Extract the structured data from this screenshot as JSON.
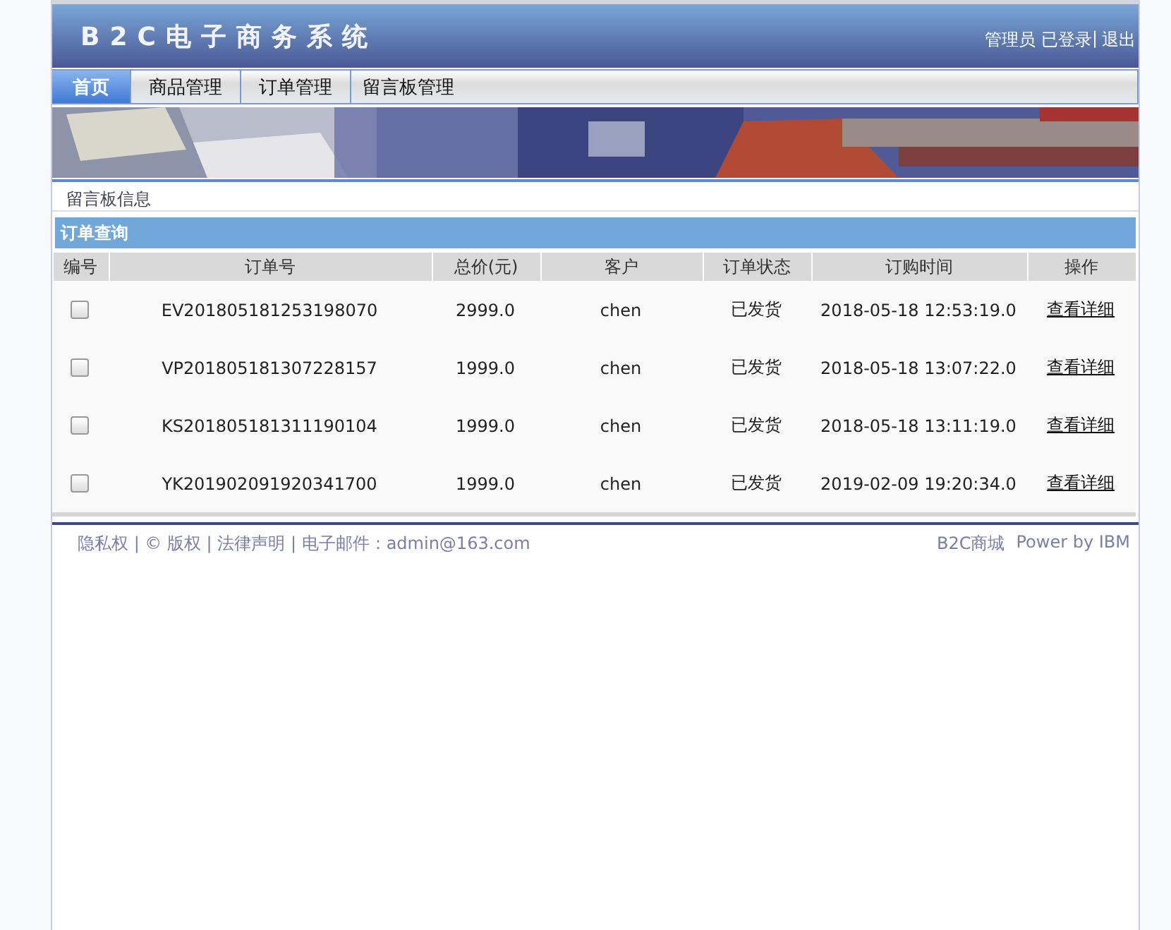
{
  "header": {
    "title": "B2C电子商务系统",
    "user": "管理员",
    "status": "已登录",
    "separator": "|",
    "logout": "退出"
  },
  "nav": [
    {
      "label": "首页",
      "selected": true
    },
    {
      "label": "商品管理",
      "selected": false
    },
    {
      "label": "订单管理",
      "selected": false
    },
    {
      "label": "留言板管理",
      "selected": false
    }
  ],
  "breadcrumb": "留言板信息",
  "section_title": "订单查询",
  "table": {
    "columns": [
      "编号",
      "订单号",
      "总价(元)",
      "客户",
      "订单状态",
      "订购时间",
      "操作"
    ],
    "rows": [
      {
        "checked": false,
        "order_no": "EV201805181253198070",
        "total": "2999.0",
        "customer": "chen",
        "status": "已发货",
        "time": "2018-05-18 12:53:19.0",
        "action": "查看详细"
      },
      {
        "checked": false,
        "order_no": "VP201805181307228157",
        "total": "1999.0",
        "customer": "chen",
        "status": "已发货",
        "time": "2018-05-18 13:07:22.0",
        "action": "查看详细"
      },
      {
        "checked": false,
        "order_no": "KS201805181311190104",
        "total": "1999.0",
        "customer": "chen",
        "status": "已发货",
        "time": "2018-05-18 13:11:19.0",
        "action": "查看详细"
      },
      {
        "checked": false,
        "order_no": "YK201902091920341700",
        "total": "1999.0",
        "customer": "chen",
        "status": "已发货",
        "time": "2019-02-09 19:20:34.0",
        "action": "查看详细"
      }
    ]
  },
  "footer": {
    "links": "隐私权 | © 版权 | 法律声明 | 电子邮件：admin@163.com",
    "brand": "B2C商城",
    "power": "Power by IBM"
  }
}
